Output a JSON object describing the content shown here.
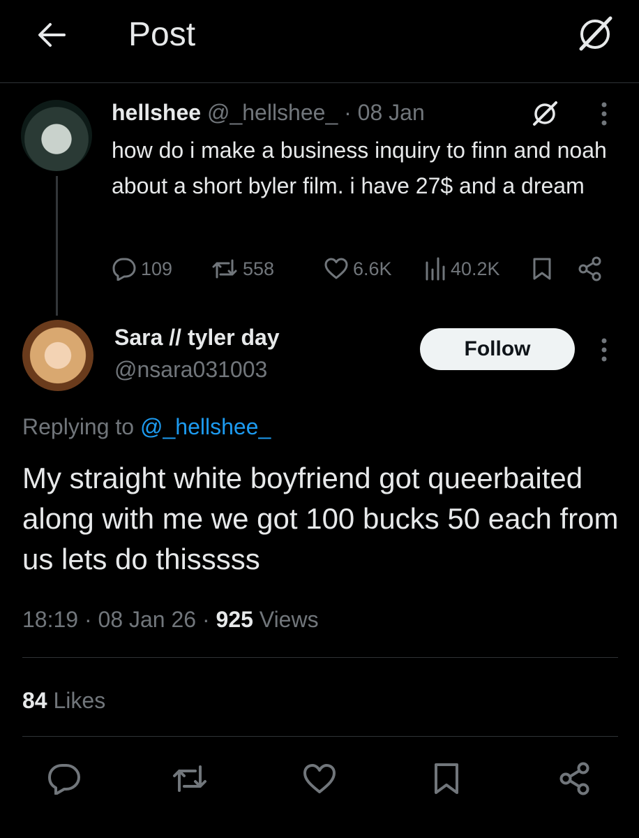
{
  "header": {
    "title": "Post",
    "back_icon": "arrow-left-icon",
    "grok_icon": "grok-icon"
  },
  "parent_tweet": {
    "name": "hellshee",
    "handle": "@_hellshee_",
    "separator": "·",
    "date": "08 Jan",
    "text": "how do i make a business inquiry to finn and noah about a short byler film. i have 27$ and a dream",
    "stats": {
      "replies": "109",
      "reposts": "558",
      "likes": "6.6K",
      "views": "40.2K"
    }
  },
  "reply_tweet": {
    "name": "Sara // tyler day",
    "handle": "@nsara031003",
    "follow_label": "Follow",
    "replying_prefix": "Replying to",
    "replying_to": "@_hellshee_",
    "text": "My straight white boyfriend got queerbaited along with me we got 100 bucks 50 each from us lets do thisssss",
    "time": "18:19",
    "date": "08 Jan 26",
    "sep": "·",
    "views_count": "925",
    "views_label": "Views",
    "likes_count": "84",
    "likes_label": "Likes"
  },
  "colors": {
    "background": "#000000",
    "text": "#e7e9ea",
    "muted": "#71767b",
    "link": "#1d9bf0",
    "divider": "#2f3336"
  }
}
